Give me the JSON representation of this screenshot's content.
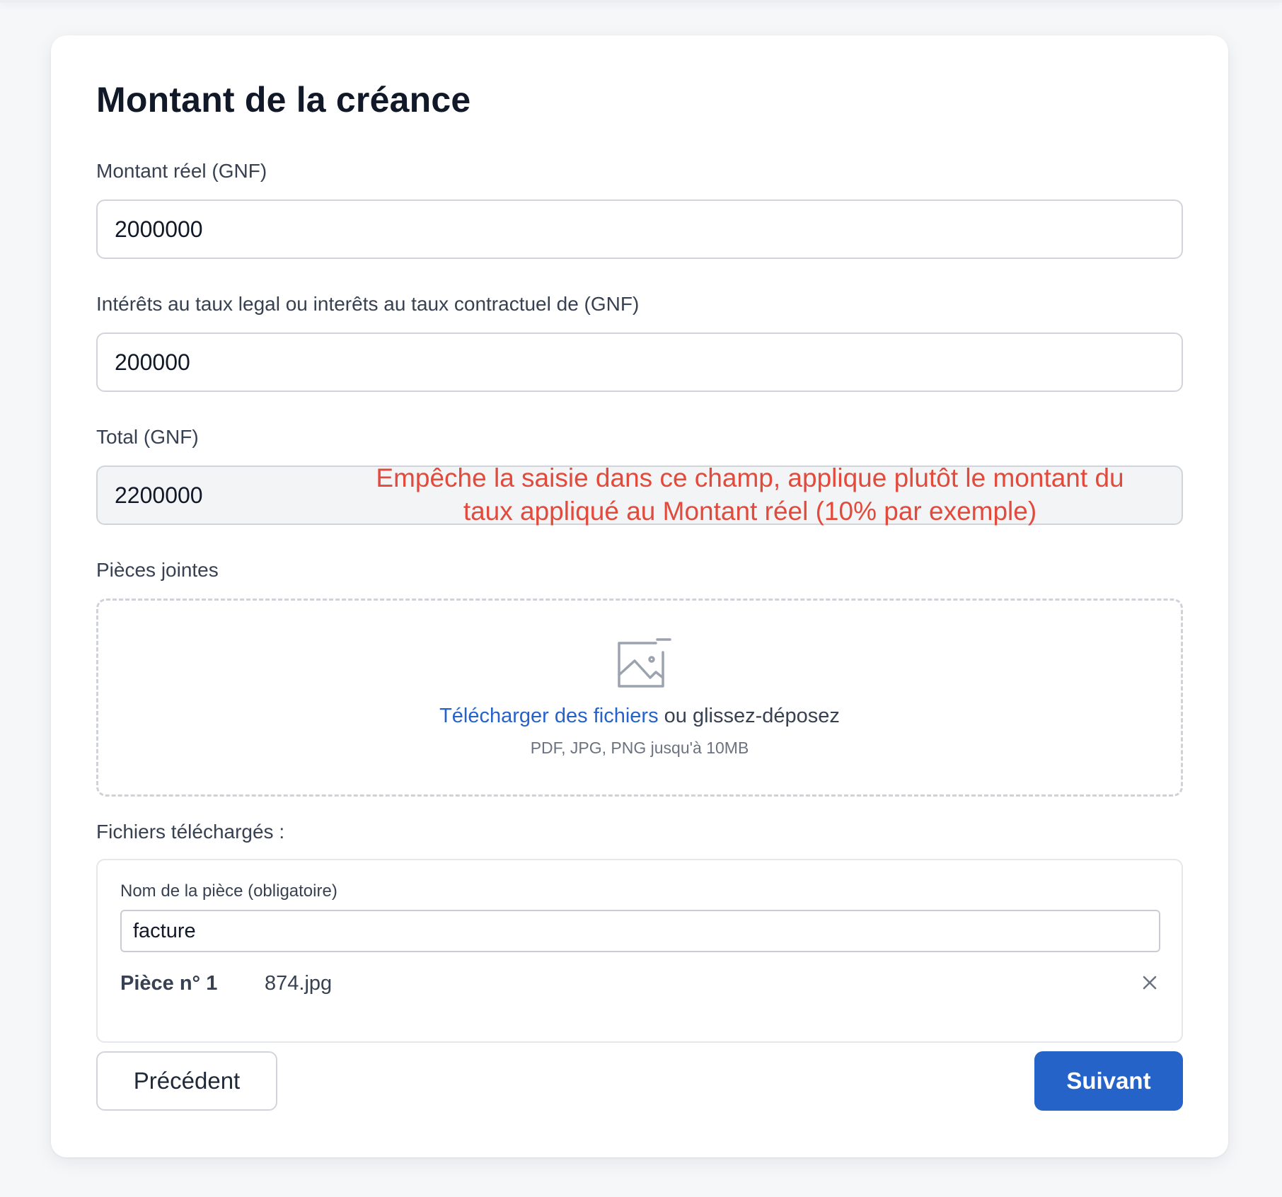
{
  "form": {
    "title": "Montant de la créance",
    "montant_reel": {
      "label": "Montant réel (GNF)",
      "value": "2000000"
    },
    "interets": {
      "label": "Intérêts au taux legal ou interêts au taux contractuel de (GNF)",
      "value": "200000"
    },
    "total": {
      "label": "Total (GNF)",
      "value": "2200000",
      "disabled": true
    },
    "annotation": "Empêche la saisie dans ce champ, applique plutôt le montant du taux appliqué au Montant réel (10% par exemple)"
  },
  "attachments": {
    "label": "Pièces jointes",
    "upload_icon": "image-upload-icon",
    "upload_link": "Télécharger des fichiers",
    "upload_text": "ou glissez-déposez",
    "hint": "PDF, JPG, PNG jusqu'à 10MB"
  },
  "uploaded": {
    "label": "Fichiers téléchargés :",
    "files": [
      {
        "name_label": "Nom de la pièce (obligatoire)",
        "name_value": "facture",
        "piece_label": "Pièce n° 1",
        "file_icon": "document-icon",
        "file_name": "874.jpg",
        "remove_icon": "close-icon"
      }
    ]
  },
  "actions": {
    "previous": "Précédent",
    "next": "Suivant"
  },
  "colors": {
    "primary": "#2563c9",
    "annotation": "#e24a3b",
    "background": "#f6f7f9"
  }
}
